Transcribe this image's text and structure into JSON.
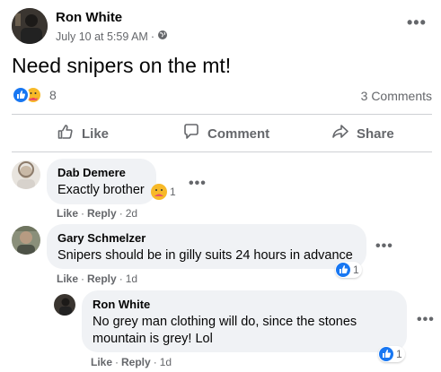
{
  "post": {
    "author": "Ron White",
    "date": "July 10 at 5:59 AM",
    "meta_sep": "·",
    "privacy_icon": "globe-icon",
    "text": "Need snipers on the mt!",
    "reactions": {
      "icons": [
        "like-icon",
        "care-icon"
      ],
      "count": "8"
    },
    "comments_count": "3 Comments"
  },
  "actions": {
    "like": "Like",
    "comment": "Comment",
    "share": "Share"
  },
  "comments": [
    {
      "author": "Dab Demere",
      "text": "Exactly brother",
      "reaction_icon": "care-icon",
      "reaction_count": "1",
      "like": "Like",
      "reply": "Reply",
      "time": "2d"
    },
    {
      "author": "Gary Schmelzer",
      "text": "Snipers should be in gilly suits 24 hours in advance",
      "reaction_icon": "like-icon",
      "reaction_count": "1",
      "like": "Like",
      "reply": "Reply",
      "time": "1d"
    },
    {
      "author": "Ron White",
      "text_line1": "No grey man clothing will do, since the stones",
      "text_line2": "mountain is grey! Lol",
      "reaction_icon": "like-icon",
      "reaction_count": "1",
      "like": "Like",
      "reply": "Reply",
      "time": "1d"
    }
  ],
  "colors": {
    "like_blue": "#1877f2",
    "care_yellow": "#f7b928",
    "muted_text": "#65676b",
    "bubble_bg": "#f0f2f5"
  }
}
